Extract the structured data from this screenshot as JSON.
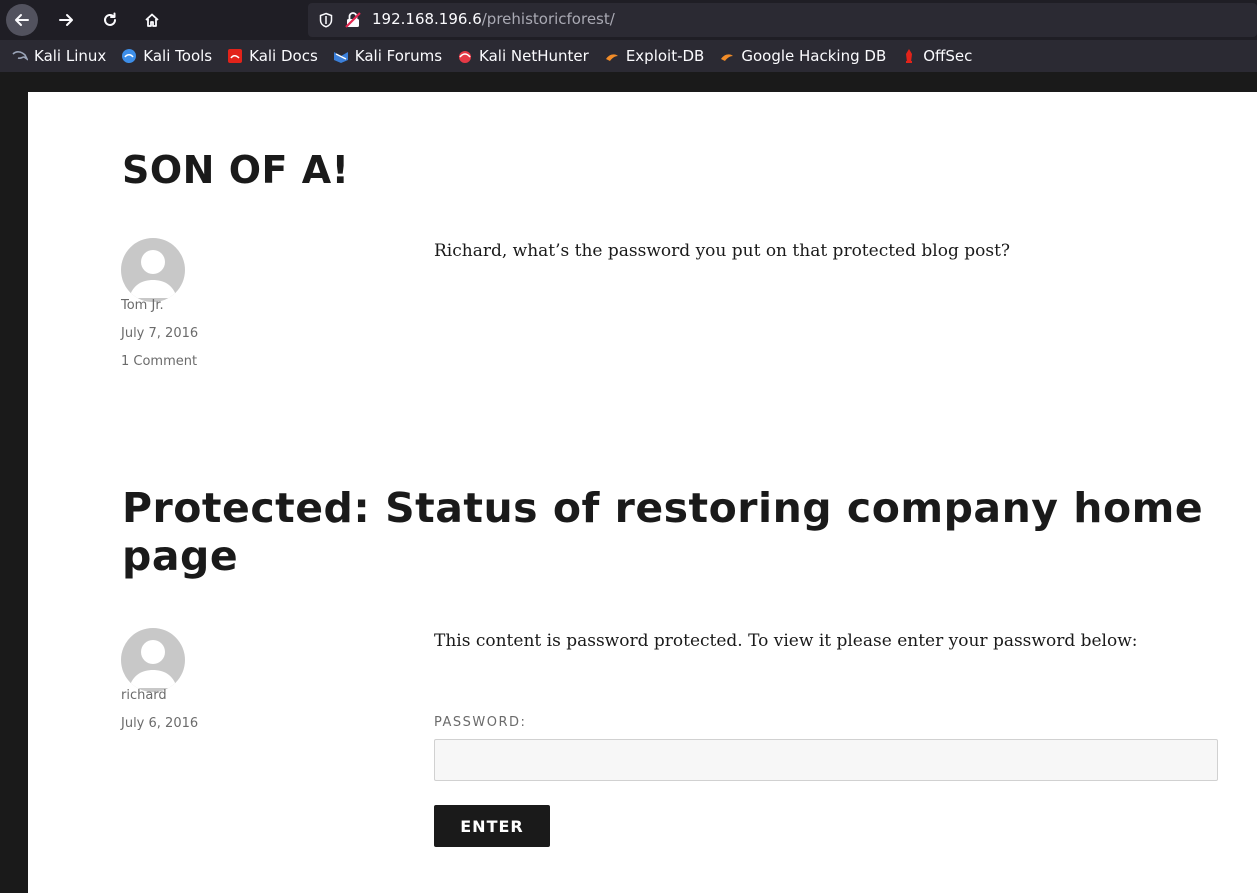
{
  "browser": {
    "url_host": "192.168.196.6",
    "url_path": "/prehistoricforest/",
    "bookmarks": [
      {
        "label": "Kali Linux",
        "icon": "kali-dragon-icon",
        "color": "#9aa4b8"
      },
      {
        "label": "Kali Tools",
        "icon": "kali-tools-icon",
        "color": "#3d8ee8"
      },
      {
        "label": "Kali Docs",
        "icon": "kali-docs-icon",
        "color": "#e2231a"
      },
      {
        "label": "Kali Forums",
        "icon": "kali-forums-icon",
        "color": "#3b7fd9"
      },
      {
        "label": "Kali NetHunter",
        "icon": "kali-nethunter-icon",
        "color": "#e63946"
      },
      {
        "label": "Exploit-DB",
        "icon": "exploit-db-icon",
        "color": "#f28c28"
      },
      {
        "label": "Google Hacking DB",
        "icon": "ghdb-icon",
        "color": "#f28c28"
      },
      {
        "label": "OffSec",
        "icon": "offsec-icon",
        "color": "#e2231a"
      }
    ]
  },
  "posts": [
    {
      "title": "SON OF A!",
      "author": "Tom Jr.",
      "date": "July 7, 2016",
      "comments": "1 Comment",
      "content": "Richard, what’s the password you put on that protected blog post?"
    },
    {
      "title": "Protected: Status of restoring company home page",
      "author": "richard",
      "date": "July 6, 2016",
      "content": "This content is password protected. To view it please enter your password below:",
      "password_label": "PASSWORD:",
      "password_value": "",
      "submit_label": "ENTER"
    }
  ]
}
